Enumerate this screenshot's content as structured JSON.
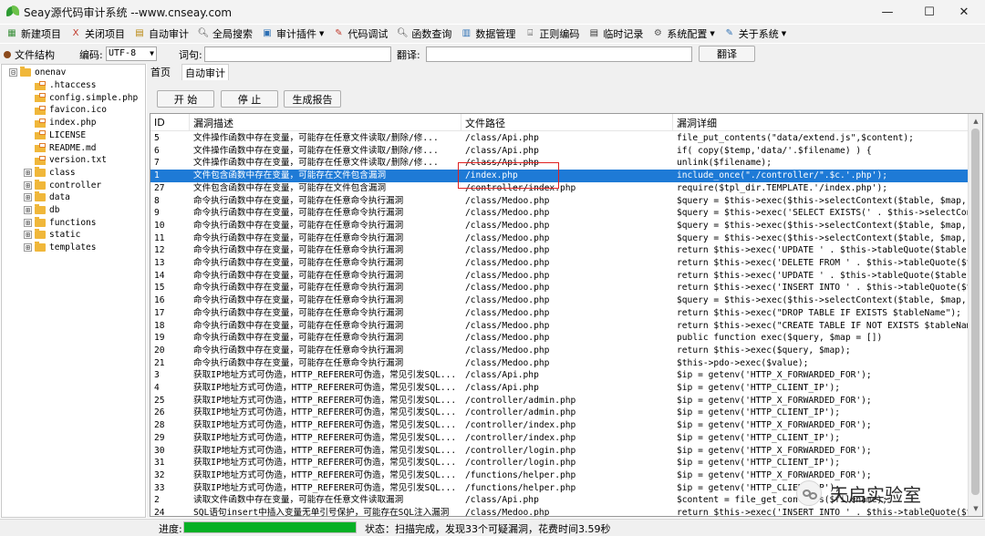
{
  "window": {
    "title": "Seay源代码审计系统  --www.cnseay.com",
    "minimize_glyph": "—",
    "maximize_glyph": "☐",
    "close_glyph": "✕"
  },
  "toolbar": {
    "items": [
      {
        "label": "新建项目",
        "icon": "new-project-icon",
        "glyph": "▦",
        "color": "#3a8f3a",
        "dropdown": false
      },
      {
        "label": "关闭项目",
        "icon": "close-project-icon",
        "glyph": "X",
        "color": "#c0392b",
        "dropdown": false
      },
      {
        "label": "自动审计",
        "icon": "auto-audit-icon",
        "glyph": "▤",
        "color": "#b8860b",
        "dropdown": false
      },
      {
        "label": "全局搜索",
        "icon": "search-icon",
        "glyph": "🔍︎",
        "color": "#444444",
        "dropdown": false
      },
      {
        "label": "审计插件",
        "icon": "plugin-icon",
        "glyph": "▣",
        "color": "#2c6fb3",
        "dropdown": true
      },
      {
        "label": "代码调试",
        "icon": "debug-icon",
        "glyph": "✎",
        "color": "#c0392b",
        "dropdown": false
      },
      {
        "label": "函数查询",
        "icon": "function-query-icon",
        "glyph": "🔍︎",
        "color": "#444444",
        "dropdown": false
      },
      {
        "label": "数据管理",
        "icon": "data-manage-icon",
        "glyph": "▥",
        "color": "#2c6fb3",
        "dropdown": false
      },
      {
        "label": "正则编码",
        "icon": "regex-icon",
        "glyph": "⌸",
        "color": "#555555",
        "dropdown": false
      },
      {
        "label": "临时记录",
        "icon": "note-icon",
        "glyph": "▤",
        "color": "#333333",
        "dropdown": false
      },
      {
        "label": "系统配置",
        "icon": "gear-icon",
        "glyph": "⚙",
        "color": "#555555",
        "dropdown": true
      },
      {
        "label": "关于系统",
        "icon": "about-icon",
        "glyph": "✎",
        "color": "#2c6fb3",
        "dropdown": true
      }
    ]
  },
  "bar2": {
    "file_structure_label": "文件结构",
    "encoding_label": "编码:",
    "encoding_value": "UTF-8",
    "word_label": "词句:",
    "translate_label": "翻译:",
    "translate_button": "翻译"
  },
  "tree": {
    "nodes": [
      {
        "label": "onenav",
        "kind": "folder",
        "expander": "⊟",
        "indent": 0
      },
      {
        "label": ".htaccess",
        "kind": "file",
        "expander": "",
        "indent": 1
      },
      {
        "label": "config.simple.php",
        "kind": "file",
        "expander": "",
        "indent": 1
      },
      {
        "label": "favicon.ico",
        "kind": "file",
        "expander": "",
        "indent": 1
      },
      {
        "label": "index.php",
        "kind": "file",
        "expander": "",
        "indent": 1
      },
      {
        "label": "LICENSE",
        "kind": "file",
        "expander": "",
        "indent": 1
      },
      {
        "label": "README.md",
        "kind": "file",
        "expander": "",
        "indent": 1
      },
      {
        "label": "version.txt",
        "kind": "file",
        "expander": "",
        "indent": 1
      },
      {
        "label": "class",
        "kind": "folder",
        "expander": "⊞",
        "indent": 1
      },
      {
        "label": "controller",
        "kind": "folder",
        "expander": "⊞",
        "indent": 1
      },
      {
        "label": "data",
        "kind": "folder",
        "expander": "⊞",
        "indent": 1
      },
      {
        "label": "db",
        "kind": "folder",
        "expander": "⊞",
        "indent": 1
      },
      {
        "label": "functions",
        "kind": "folder",
        "expander": "⊞",
        "indent": 1
      },
      {
        "label": "static",
        "kind": "folder",
        "expander": "⊞",
        "indent": 1
      },
      {
        "label": "templates",
        "kind": "folder",
        "expander": "⊞",
        "indent": 1
      }
    ]
  },
  "tabs": [
    {
      "label": "首页",
      "active": false
    },
    {
      "label": "自动审计",
      "active": true
    }
  ],
  "actions": {
    "start": "开 始",
    "stop": "停 止",
    "report": "生成报告"
  },
  "table": {
    "columns": [
      "ID",
      "漏洞描述",
      "文件路径",
      "漏洞详细"
    ],
    "selected_index": 3,
    "rows": [
      [
        "5",
        "文件操作函数中存在变量，可能存在任意文件读取/删除/修...",
        "/class/Api.php",
        "file_put_contents(\"data/extend.js\",$content);"
      ],
      [
        "6",
        "文件操作函数中存在变量，可能存在任意文件读取/删除/修...",
        "/class/Api.php",
        "if( copy($temp,'data/'.$filename) ) {"
      ],
      [
        "7",
        "文件操作函数中存在变量，可能存在任意文件读取/删除/修...",
        "/class/Api.php",
        "unlink($filename);"
      ],
      [
        "1",
        "文件包含函数中存在变量，可能存在文件包含漏洞",
        "/index.php",
        "include_once(\"./controller/\".$c.'.php');"
      ],
      [
        "27",
        "文件包含函数中存在变量，可能存在文件包含漏洞",
        "/controller/index.php",
        "require($tpl_dir.TEMPLATE.'/index.php');"
      ],
      [
        "8",
        "命令执行函数中存在变量，可能存在任意命令执行漏洞",
        "/class/Medoo.php",
        "$query = $this->exec($this->selectContext($table, $map, $..."
      ],
      [
        "9",
        "命令执行函数中存在变量，可能存在任意命令执行漏洞",
        "/class/Medoo.php",
        "$query = $this->exec('SELECT EXISTS(' . $this->selectCont..."
      ],
      [
        "10",
        "命令执行函数中存在变量，可能存在任意命令执行漏洞",
        "/class/Medoo.php",
        "$query = $this->exec($this->selectContext($table, $map, $..."
      ],
      [
        "11",
        "命令执行函数中存在变量，可能存在任意命令执行漏洞",
        "/class/Medoo.php",
        "$query = $this->exec($this->selectContext($table, $map, $..."
      ],
      [
        "12",
        "命令执行函数中存在变量，可能存在任意命令执行漏洞",
        "/class/Medoo.php",
        "return $this->exec('UPDATE ' . $this->tableQuote($table) ..."
      ],
      [
        "13",
        "命令执行函数中存在变量，可能存在任意命令执行漏洞",
        "/class/Medoo.php",
        "return $this->exec('DELETE FROM ' . $this->tableQuote($ta..."
      ],
      [
        "14",
        "命令执行函数中存在变量，可能存在任意命令执行漏洞",
        "/class/Medoo.php",
        "return $this->exec('UPDATE ' . $this->tableQuote($table) ..."
      ],
      [
        "15",
        "命令执行函数中存在变量，可能存在任意命令执行漏洞",
        "/class/Medoo.php",
        "return $this->exec('INSERT INTO ' . $this->tableQuote($ta..."
      ],
      [
        "16",
        "命令执行函数中存在变量，可能存在任意命令执行漏洞",
        "/class/Medoo.php",
        "$query = $this->exec($this->selectContext($table, $map, $..."
      ],
      [
        "17",
        "命令执行函数中存在变量，可能存在任意命令执行漏洞",
        "/class/Medoo.php",
        "return $this->exec(\"DROP TABLE IF EXISTS $tableName\");"
      ],
      [
        "18",
        "命令执行函数中存在变量，可能存在任意命令执行漏洞",
        "/class/Medoo.php",
        "return $this->exec(\"CREATE TABLE IF NOT EXISTS $tableName..."
      ],
      [
        "19",
        "命令执行函数中存在变量，可能存在任意命令执行漏洞",
        "/class/Medoo.php",
        "public function exec($query, $map = [])"
      ],
      [
        "20",
        "命令执行函数中存在变量，可能存在任意命令执行漏洞",
        "/class/Medoo.php",
        "return $this->exec($query, $map);"
      ],
      [
        "21",
        "命令执行函数中存在变量，可能存在任意命令执行漏洞",
        "/class/Medoo.php",
        "$this->pdo->exec($value);"
      ],
      [
        "3",
        "获取IP地址方式可伪造，HTTP_REFERER可伪造，常见引发SQL...",
        "/class/Api.php",
        "$ip = getenv('HTTP_X_FORWARDED_FOR');"
      ],
      [
        "4",
        "获取IP地址方式可伪造，HTTP_REFERER可伪造，常见引发SQL...",
        "/class/Api.php",
        "$ip = getenv('HTTP_CLIENT_IP');"
      ],
      [
        "25",
        "获取IP地址方式可伪造，HTTP_REFERER可伪造，常见引发SQL...",
        "/controller/admin.php",
        "$ip = getenv('HTTP_X_FORWARDED_FOR');"
      ],
      [
        "26",
        "获取IP地址方式可伪造，HTTP_REFERER可伪造，常见引发SQL...",
        "/controller/admin.php",
        "$ip = getenv('HTTP_CLIENT_IP');"
      ],
      [
        "28",
        "获取IP地址方式可伪造，HTTP_REFERER可伪造，常见引发SQL...",
        "/controller/index.php",
        "$ip = getenv('HTTP_X_FORWARDED_FOR');"
      ],
      [
        "29",
        "获取IP地址方式可伪造，HTTP_REFERER可伪造，常见引发SQL...",
        "/controller/index.php",
        "$ip = getenv('HTTP_CLIENT_IP');"
      ],
      [
        "30",
        "获取IP地址方式可伪造，HTTP_REFERER可伪造，常见引发SQL...",
        "/controller/login.php",
        "$ip = getenv('HTTP_X_FORWARDED_FOR');"
      ],
      [
        "31",
        "获取IP地址方式可伪造，HTTP_REFERER可伪造，常见引发SQL...",
        "/controller/login.php",
        "$ip = getenv('HTTP_CLIENT_IP');"
      ],
      [
        "32",
        "获取IP地址方式可伪造，HTTP_REFERER可伪造，常见引发SQL...",
        "/functions/helper.php",
        "$ip = getenv('HTTP_X_FORWARDED_FOR');"
      ],
      [
        "33",
        "获取IP地址方式可伪造，HTTP_REFERER可伪造，常见引发SQL...",
        "/functions/helper.php",
        "$ip = getenv('HTTP_CLIENT_IP');"
      ],
      [
        "2",
        "读取文件函数中存在变量，可能存在任意文件读取漏洞",
        "/class/Api.php",
        "$content = file_get_contents($filename);"
      ],
      [
        "24",
        "SQL语句insert中插入变量无单引号保护，可能存在SQL注入漏洞",
        "/class/Medoo.php",
        "return $this->exec('INSERT INTO ' . $this->tableQuote($ta..."
      ]
    ]
  },
  "status": {
    "progress_label": "进度:",
    "progress_fraction": 1.0,
    "progress_color": "#06b025",
    "status_text": "状态：扫描完成，发现33个可疑漏洞，花费时间3.59秒"
  },
  "watermark": {
    "text": "天启实验室",
    "icon": "wechat-icon"
  },
  "colors": {
    "selection": "#1e7ad6",
    "highlight_box": "#e02020",
    "folder": "#f0b73a"
  }
}
